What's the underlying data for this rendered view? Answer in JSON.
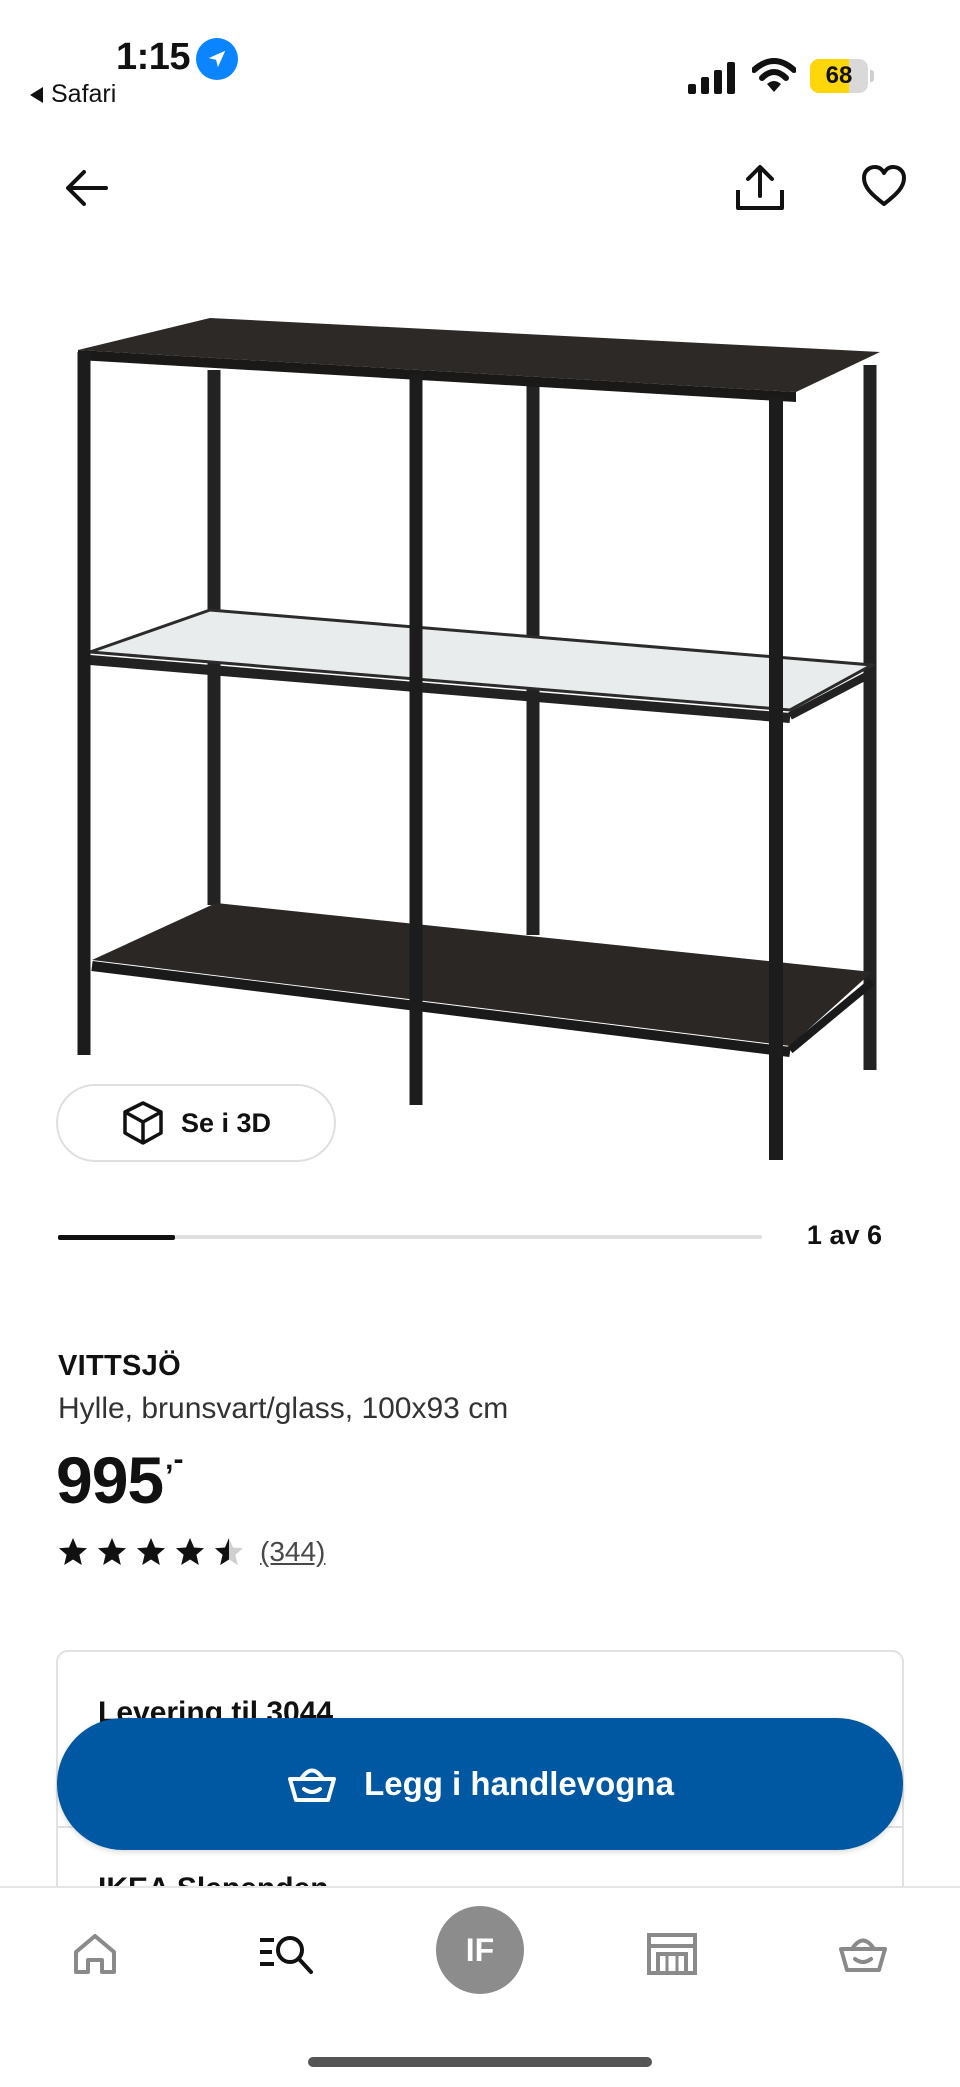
{
  "status_bar": {
    "time": "1:15",
    "back_app": "Safari",
    "battery_level": "68",
    "battery_fraction": 0.68,
    "location_icon": "location-arrow-icon",
    "signal_icon": "cellular-signal-icon",
    "wifi_icon": "wifi-icon"
  },
  "header": {
    "back_icon": "arrow-left-icon",
    "share_icon": "share-icon",
    "favourite_icon": "heart-icon"
  },
  "gallery": {
    "view_3d_label": "Se i 3D",
    "counter": "1 av 6",
    "current_index": 1,
    "total": 6
  },
  "product": {
    "name": "VITTSJÖ",
    "description": "Hylle, brunsvart/glass, 100x93 cm",
    "price": "995",
    "price_suffix": ",-",
    "rating": 4.5,
    "rating_max": 5,
    "review_count": "(344)"
  },
  "availability": {
    "delivery_title": "Levering til 3044",
    "store_title": "IKEA Slependen"
  },
  "cta": {
    "label": "Legg i handlevogna",
    "icon": "basket-icon"
  },
  "bottom_nav": {
    "items": [
      {
        "icon": "home-icon"
      },
      {
        "icon": "search-list-icon"
      },
      {
        "icon": "account-avatar",
        "label": "IF"
      },
      {
        "icon": "store-icon"
      },
      {
        "icon": "basket-icon"
      }
    ]
  },
  "colors": {
    "primary_blue": "#0058a3",
    "ios_blue": "#0a84ff",
    "battery_yellow": "#ffd60a",
    "text": "#111111",
    "avatar_gray": "#8c8c8c"
  }
}
